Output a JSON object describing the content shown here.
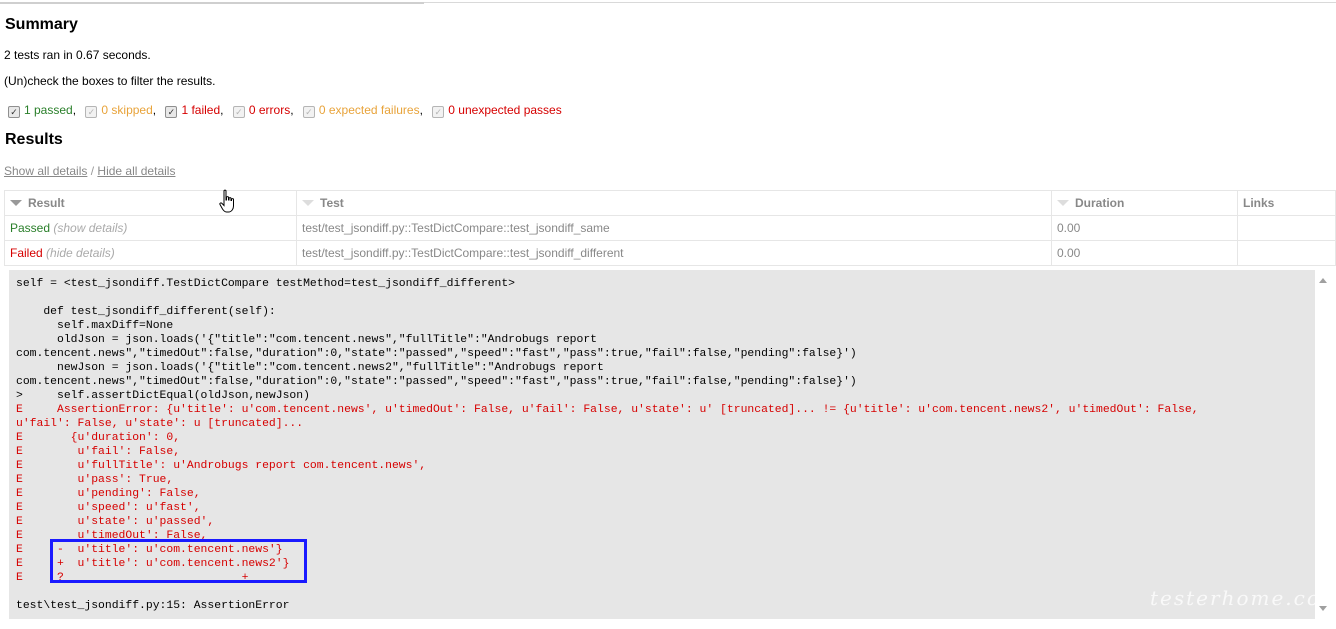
{
  "summary": {
    "title": "Summary",
    "tests_ran": "2 tests ran in 0.67 seconds.",
    "instruction": "(Un)check the boxes to filter the results."
  },
  "filters": [
    {
      "label": "1 passed",
      "checked": true
    },
    {
      "label": "0 skipped",
      "checked": false
    },
    {
      "label": "1 failed",
      "checked": true
    },
    {
      "label": "0 errors",
      "checked": false
    },
    {
      "label": "0 expected failures",
      "checked": false
    },
    {
      "label": "0 unexpected passes",
      "checked": false
    }
  ],
  "results": {
    "title": "Results",
    "show_all": "Show all details",
    "slash": " / ",
    "hide_all": "Hide all details",
    "columns": [
      "Result",
      "Test",
      "Duration",
      "Links"
    ],
    "rows": [
      {
        "result": "Passed",
        "details": "(show details)",
        "test": "test/test_jsondiff.py::TestDictCompare::test_jsondiff_same",
        "duration": "0.00",
        "links": ""
      },
      {
        "result": "Failed",
        "details": "(hide details)",
        "test": "test/test_jsondiff.py::TestDictCompare::test_jsondiff_different",
        "duration": "0.00",
        "links": ""
      }
    ]
  },
  "log": {
    "lines": [
      "self = <test_jsondiff.TestDictCompare testMethod=test_jsondiff_different>",
      "",
      "    def test_jsondiff_different(self):",
      "      self.maxDiff=None",
      "      oldJson = json.loads('{\"title\":\"com.tencent.news\",\"fullTitle\":\"Androbugs report",
      "com.tencent.news\",\"timedOut\":false,\"duration\":0,\"state\":\"passed\",\"speed\":\"fast\",\"pass\":true,\"fail\":false,\"pending\":false}')",
      "      newJson = json.loads('{\"title\":\"com.tencent.news2\",\"fullTitle\":\"Androbugs report",
      "com.tencent.news\",\"timedOut\":false,\"duration\":0,\"state\":\"passed\",\"speed\":\"fast\",\"pass\":true,\"fail\":false,\"pending\":false}')",
      ">     self.assertDictEqual(oldJson,newJson)"
    ],
    "error_lines": [
      "E     AssertionError: {u'title': u'com.tencent.news', u'timedOut': False, u'fail': False, u'state': u' [truncated]... != {u'title': u'com.tencent.news2', u'timedOut': False,",
      "u'fail': False, u'state': u [truncated]...",
      "E       {u'duration': 0,",
      "E        u'fail': False,",
      "E        u'fullTitle': u'Androbugs report com.tencent.news',",
      "E        u'pass': True,",
      "E        u'pending': False,",
      "E        u'speed': u'fast',",
      "E        u'state': u'passed',",
      "E        u'timedOut': False,",
      "E     -  u'title': u'com.tencent.news'}",
      "E     +  u'title': u'com.tencent.news2'}",
      "E     ?                          +"
    ],
    "footer": "test\\test_jsondiff.py:15: AssertionError"
  },
  "watermark": "testerhome.com",
  "colors": {
    "passed": "#2a7f2a",
    "failed": "#d60000",
    "skipped": "#e8a33a",
    "log_bg": "#e6e6e6",
    "highlight": "#1a1aff"
  }
}
